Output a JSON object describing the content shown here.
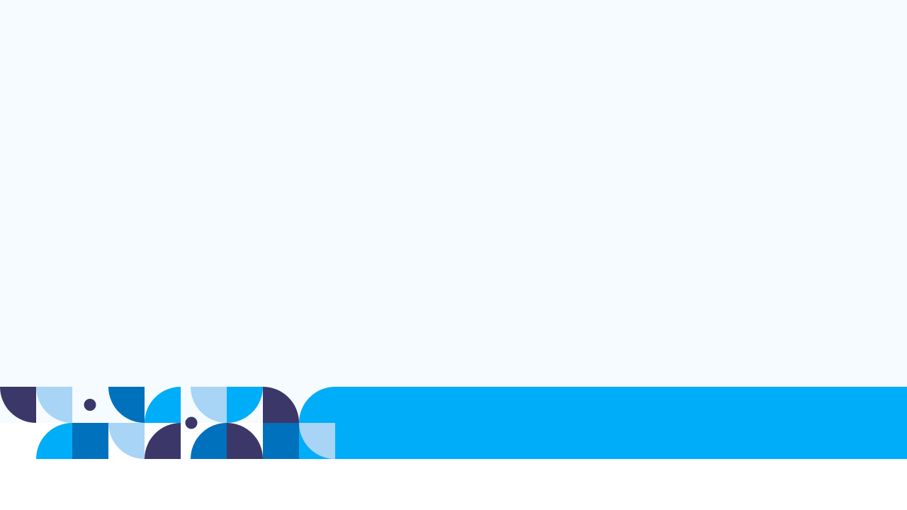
{
  "colors": {
    "background": "#f5fbfe",
    "navy": "#3b3769",
    "light_blue": "#a8d4f5",
    "medium_blue": "#0071bc",
    "bright_blue": "#00adf8",
    "white": "#ffffff"
  },
  "footer": {
    "pattern": [
      {
        "shape": "quarter-circle",
        "color": "navy"
      },
      {
        "shape": "quarter-circle",
        "color": "light_blue"
      },
      {
        "shape": "dot",
        "color": "navy"
      },
      {
        "shape": "quarter-circle",
        "color": "medium_blue"
      },
      {
        "shape": "quarter-circle",
        "color": "bright_blue"
      },
      {
        "shape": "dot",
        "color": "navy"
      },
      {
        "shape": "quarter-circle",
        "color": "light_blue"
      },
      {
        "shape": "quarter-circle",
        "color": "bright_blue"
      },
      {
        "shape": "quarter-circle",
        "color": "navy"
      },
      {
        "shape": "quarter-circle",
        "color": "bright_blue"
      },
      {
        "shape": "square",
        "color": "medium_blue"
      },
      {
        "shape": "quarter-circle",
        "color": "light_blue"
      },
      {
        "shape": "quarter-circle",
        "color": "navy"
      },
      {
        "shape": "quarter-circle",
        "color": "medium_blue"
      },
      {
        "shape": "quarter-circle",
        "color": "navy"
      },
      {
        "shape": "square",
        "color": "medium_blue"
      },
      {
        "shape": "quarter-circle",
        "color": "light_blue"
      }
    ],
    "bar_color": "bright_blue"
  }
}
